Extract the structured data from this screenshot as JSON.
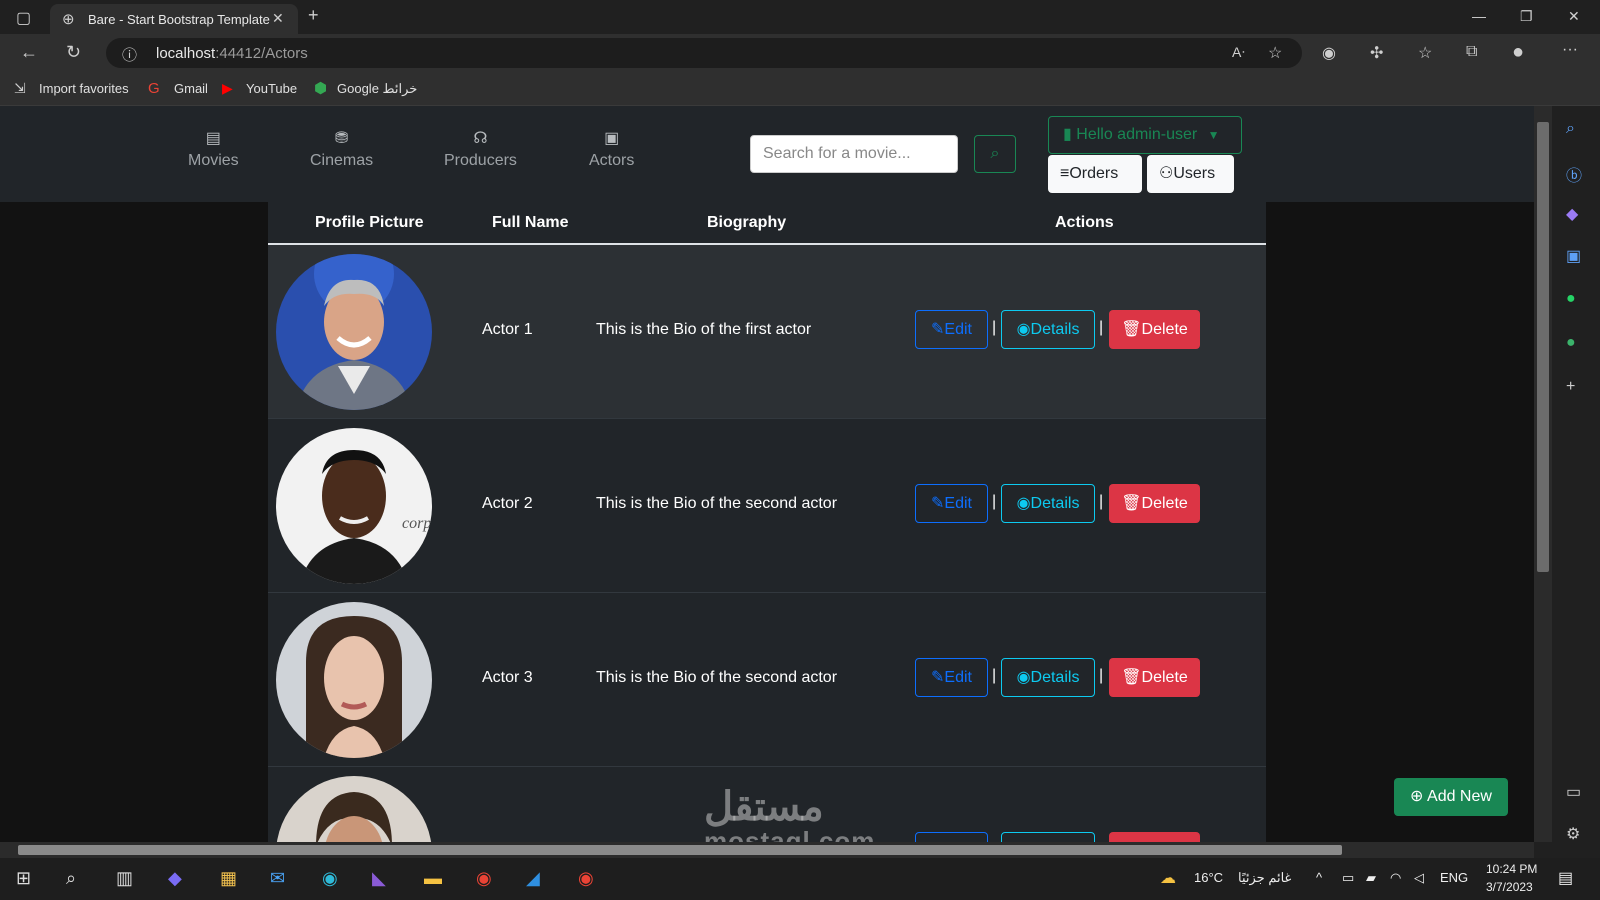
{
  "browser": {
    "tab_title": "Bare - Start Bootstrap Template",
    "url_host": "localhost",
    "url_path": ":44412/Actors",
    "favorites": [
      "Import favorites",
      "Gmail",
      "YouTube",
      "Google خرائط"
    ]
  },
  "navbar": {
    "items": [
      {
        "label": "Movies",
        "icon": "film-icon"
      },
      {
        "label": "Cinemas",
        "icon": "cinema-icon"
      },
      {
        "label": "Producers",
        "icon": "headphones-icon"
      },
      {
        "label": "Actors",
        "icon": "person-badge-icon"
      }
    ],
    "search_placeholder": "Search for a movie...",
    "user_label": "Hello admin-user",
    "orders_label": "Orders",
    "users_label": "Users"
  },
  "table": {
    "headers": [
      "Profile Picture",
      "Full Name",
      "Biography",
      "Actions"
    ],
    "rows": [
      {
        "name": "Actor 1",
        "bio": "This is the Bio of the first actor"
      },
      {
        "name": "Actor 2",
        "bio": "This is the Bio of the second actor"
      },
      {
        "name": "Actor 3",
        "bio": "This is the Bio of the second actor"
      },
      {
        "name": "",
        "bio": ""
      }
    ],
    "edit_label": "Edit",
    "details_label": "Details",
    "delete_label": "Delete",
    "separator": "|"
  },
  "add_new_label": "Add New",
  "watermark": {
    "line1": "مستقل",
    "line2": "mostaql.com"
  },
  "taskbar": {
    "weather": "16°C",
    "weather_text": "غائم جزئيًا",
    "lang": "ENG",
    "time": "10:24 PM",
    "date": "3/7/2023"
  },
  "colors": {
    "success": "#198754",
    "primary": "#0d6efd",
    "info": "#0dcaf0",
    "danger": "#dc3545",
    "table_bg": "#212529"
  }
}
